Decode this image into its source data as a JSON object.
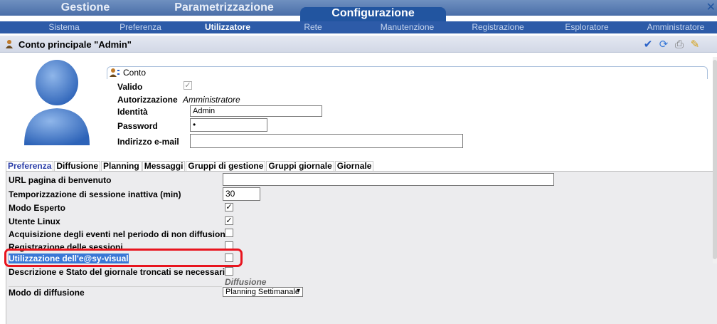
{
  "top_tabs": [
    {
      "label": "Gestione"
    },
    {
      "label": "Parametrizzazione"
    },
    {
      "label": "Configurazione"
    }
  ],
  "sub_menu": [
    {
      "label": "Sistema"
    },
    {
      "label": "Preferenza"
    },
    {
      "label": "Utilizzatore"
    },
    {
      "label": "Rete"
    },
    {
      "label": "Manutenzione"
    },
    {
      "label": "Registrazione"
    },
    {
      "label": "Esploratore"
    },
    {
      "label": "Amministratore"
    }
  ],
  "title": "Conto principale \"Admin\"",
  "toolbar_icons": [
    "check-icon",
    "refresh-icon",
    "print-icon",
    "edit-icon"
  ],
  "conto": {
    "heading": "Conto",
    "valido_label": "Valido",
    "valido_checked": true,
    "autorizzazione_label": "Autorizzazione",
    "autorizzazione_value": "Amministratore",
    "identita_label": "Identità",
    "identita_value": "Admin",
    "password_label": "Password",
    "password_value": "•",
    "email_label": "Indirizzo e-mail",
    "email_value": ""
  },
  "tabs": [
    {
      "label": "Preferenza"
    },
    {
      "label": "Diffusione"
    },
    {
      "label": "Planning"
    },
    {
      "label": "Messaggi"
    },
    {
      "label": "Gruppi di gestione"
    },
    {
      "label": "Gruppi giornale"
    },
    {
      "label": "Giornale"
    }
  ],
  "preferenza": {
    "url_label": "URL pagina di benvenuto",
    "url_value": "",
    "timeout_label": "Temporizzazione di sessione inattiva (min)",
    "timeout_value": "30",
    "esperto_label": "Modo Esperto",
    "esperto_checked": true,
    "linux_label": "Utente Linux",
    "linux_checked": true,
    "acquisizione_label": "Acquisizione degli eventi nel periodo di non diffusione",
    "acquisizione_checked": false,
    "registrazione_label": "Registrazione delle sessioni",
    "registrazione_checked": false,
    "easy_label": "Utilizzazione dell'e@sy-visual",
    "easy_checked": false,
    "descrizione_label": "Descrizione e Stato del giornale troncati se necessario",
    "descrizione_checked": false,
    "diffusione_section": "Diffusione",
    "modo_label": "Modo di diffusione",
    "modo_value": "Planning Settimanale"
  },
  "colors": {
    "topbar": "#4a6ea8",
    "submenu": "#2d5ba8",
    "highlight": "#e8141e",
    "selection": "#3a78d6"
  }
}
